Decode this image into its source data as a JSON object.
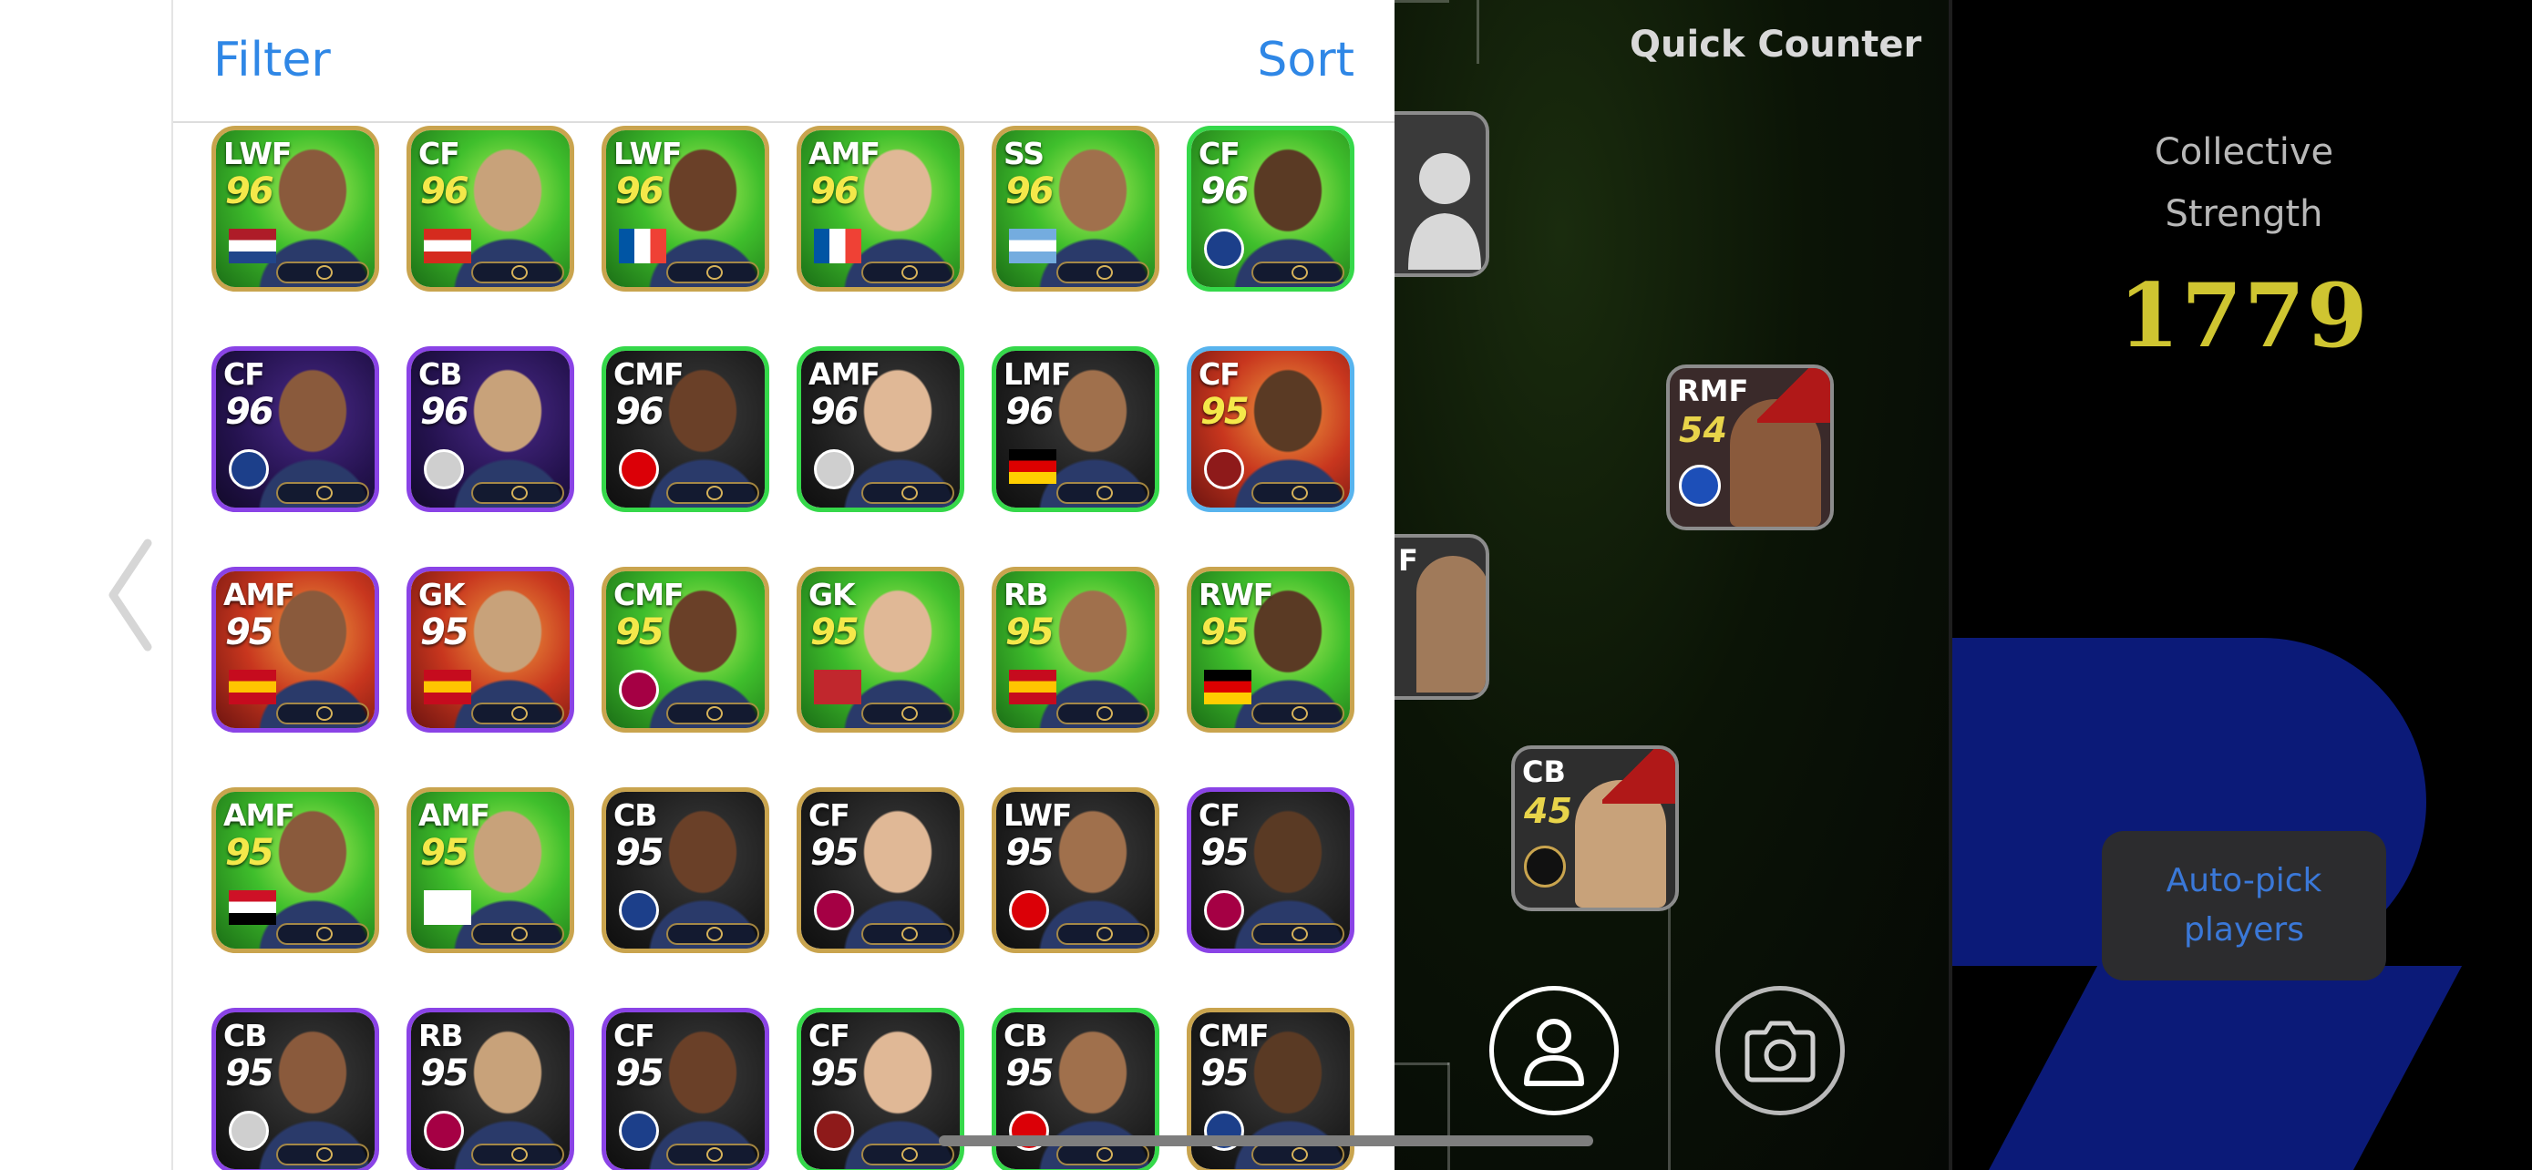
{
  "panel": {
    "filter_label": "Filter",
    "sort_label": "Sort"
  },
  "players": [
    {
      "pos": "LWF",
      "rating": "96",
      "frame": "gold",
      "bg": "green",
      "badge": "netherlands-flag",
      "ry": true
    },
    {
      "pos": "CF",
      "rating": "96",
      "frame": "gold",
      "bg": "green",
      "badge": "canada-flag",
      "ry": true
    },
    {
      "pos": "LWF",
      "rating": "96",
      "frame": "gold",
      "bg": "green",
      "badge": "france-flag",
      "ry": true
    },
    {
      "pos": "AMF",
      "rating": "96",
      "frame": "gold",
      "bg": "green",
      "badge": "france-flag",
      "ry": true
    },
    {
      "pos": "SS",
      "rating": "96",
      "frame": "gold",
      "bg": "green",
      "badge": "argentina-flag",
      "ry": true
    },
    {
      "pos": "CF",
      "rating": "96",
      "frame": "green",
      "bg": "green",
      "badge": "psg-crest",
      "ry": false
    },
    {
      "pos": "CF",
      "rating": "96",
      "frame": "purple",
      "bg": "purple",
      "badge": "psg-crest",
      "ry": false
    },
    {
      "pos": "CB",
      "rating": "96",
      "frame": "purple",
      "bg": "purple",
      "badge": "club-crest",
      "ry": false
    },
    {
      "pos": "CMF",
      "rating": "96",
      "frame": "green",
      "bg": "dark",
      "badge": "arsenal-crest",
      "ry": false
    },
    {
      "pos": "AMF",
      "rating": "96",
      "frame": "green",
      "bg": "dark",
      "badge": "club-crest",
      "ry": false
    },
    {
      "pos": "LMF",
      "rating": "96",
      "frame": "green",
      "bg": "dark",
      "badge": "germany-flag",
      "ry": false
    },
    {
      "pos": "CF",
      "rating": "95",
      "frame": "blue",
      "bg": "red",
      "badge": "club-crest-red",
      "ry": true
    },
    {
      "pos": "AMF",
      "rating": "95",
      "frame": "purple",
      "bg": "red",
      "badge": "spain-flag",
      "ry": false
    },
    {
      "pos": "GK",
      "rating": "95",
      "frame": "purple",
      "bg": "red",
      "badge": "spain-flag",
      "ry": false
    },
    {
      "pos": "CMF",
      "rating": "95",
      "frame": "gold",
      "bg": "green",
      "badge": "barcelona-crest",
      "ry": true
    },
    {
      "pos": "GK",
      "rating": "95",
      "frame": "gold",
      "bg": "green",
      "badge": "morocco-flag",
      "ry": true
    },
    {
      "pos": "RB",
      "rating": "95",
      "frame": "gold",
      "bg": "green",
      "badge": "spain-flag",
      "ry": true
    },
    {
      "pos": "RWF",
      "rating": "95",
      "frame": "gold",
      "bg": "green",
      "badge": "germany-flag",
      "ry": true
    },
    {
      "pos": "AMF",
      "rating": "95",
      "frame": "gold",
      "bg": "green",
      "badge": "egypt-flag",
      "ry": true
    },
    {
      "pos": "AMF",
      "rating": "95",
      "frame": "gold",
      "bg": "green",
      "badge": "korea-flag",
      "ry": true
    },
    {
      "pos": "CB",
      "rating": "95",
      "frame": "gold",
      "bg": "dark",
      "badge": "psg-crest",
      "ry": false
    },
    {
      "pos": "CF",
      "rating": "95",
      "frame": "gold",
      "bg": "dark",
      "badge": "barcelona-crest",
      "ry": false
    },
    {
      "pos": "LWF",
      "rating": "95",
      "frame": "gold",
      "bg": "dark",
      "badge": "arsenal-crest",
      "ry": false
    },
    {
      "pos": "CF",
      "rating": "95",
      "frame": "purple",
      "bg": "dark",
      "badge": "barcelona-crest",
      "ry": false
    },
    {
      "pos": "CB",
      "rating": "95",
      "frame": "purple",
      "bg": "dark",
      "badge": "club-crest",
      "ry": false
    },
    {
      "pos": "RB",
      "rating": "95",
      "frame": "purple",
      "bg": "dark",
      "badge": "barcelona-crest",
      "ry": false
    },
    {
      "pos": "CF",
      "rating": "95",
      "frame": "purple",
      "bg": "dark",
      "badge": "psg-crest",
      "ry": false
    },
    {
      "pos": "CF",
      "rating": "95",
      "frame": "green",
      "bg": "dark",
      "badge": "club-crest-red",
      "ry": false
    },
    {
      "pos": "CB",
      "rating": "95",
      "frame": "green",
      "bg": "dark",
      "badge": "arsenal-crest",
      "ry": false
    },
    {
      "pos": "CMF",
      "rating": "95",
      "frame": "gold",
      "bg": "dark",
      "badge": "psg-crest",
      "ry": false
    }
  ],
  "pitch": {
    "title": "Quick Counter",
    "field_players": [
      {
        "pos": "RMF",
        "rating": "54"
      },
      {
        "pos": "CB",
        "rating": "45"
      }
    ],
    "edge_players": [
      {
        "pos": "",
        "rating": ""
      },
      {
        "pos": "F",
        "rating": ""
      }
    ]
  },
  "info": {
    "strength_label_line1": "Collective",
    "strength_label_line2": "Strength",
    "strength_value": "1779",
    "autopick_line1": "Auto-pick",
    "autopick_line2": "players"
  },
  "colors": {
    "accent": "#2f87e6",
    "strength_value": "#cfc531",
    "frame_gold": "#c9a44e",
    "frame_green": "#35d84a",
    "frame_purple": "#8a43e6",
    "frame_blue": "#58b4ee"
  }
}
